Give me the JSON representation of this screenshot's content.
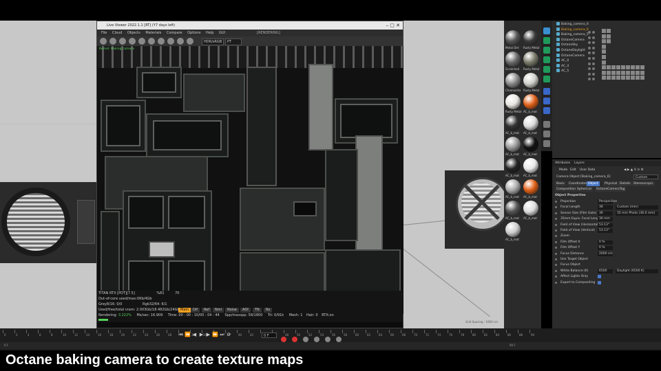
{
  "colors": {
    "accent_orange": "#f0a020",
    "selection_blue": "#4a79c8",
    "stat_green": "#58d15a",
    "viewport_grey": "#c8c8c8"
  },
  "caption": "Octane baking camera to create texture maps",
  "live_viewer": {
    "title": "Live Viewer 2022.1.1 [RT] (Y7 days left)",
    "menu": [
      "File",
      "Cloud",
      "Objects",
      "Materials",
      "Compare",
      "Options",
      "Help",
      "GUI"
    ],
    "status": "[RENDERING]",
    "toolbar": {
      "kernel_select": "HDR/sRGB",
      "mode_select": "PT"
    },
    "overlay_label": "Kernel: Baking camera",
    "stats": {
      "gpu": "TITAN RTX [PDT][7.5]",
      "gpu_pct": "%81",
      "gpu_temp": "70",
      "ooc": "Out-of-core used/max:0Kb/4Gb",
      "grey": "Grey8/16: 0/0",
      "rgb": "Rgb32/64: 6/1",
      "vram": "Used/free/total vram: 2.003Gb/18.482Gb/24Gb",
      "buttons": [
        "Main",
        "Dif",
        "Ref",
        "Nml",
        "Noise",
        "AOI",
        "TN",
        "Ro"
      ],
      "rendering_label": "Rendering:",
      "rendering_pct": "3.222%",
      "ms_sec": "Ms/sec: 16.909",
      "time": "Time: 00 : 00 : 10/00 : 04 : 44",
      "spp": "Spp/maxspp: 58/1800",
      "tri": "Tri: 0/91k",
      "mesh": "Mesh: 1",
      "hair": "Hair: 0",
      "rtx": "RTX:on"
    }
  },
  "materials": [
    {
      "label": "Metal Dirt",
      "color": "#555"
    },
    {
      "label": "Rusty Metal",
      "color": "#3a3a3a"
    },
    {
      "label": "Scratched",
      "color": "#6a6a6a"
    },
    {
      "label": "Rusty Metal",
      "color": "#7a7a6a"
    },
    {
      "label": "Chamoisite",
      "color": "#8a8a8a"
    },
    {
      "label": "Rusty Metal",
      "color": "#d0d0cc"
    },
    {
      "label": "Rusty Metal",
      "color": "#e8e6e0"
    },
    {
      "label": "AC_b_mat",
      "color": "#e06018"
    },
    {
      "label": "AC_b_mat",
      "color": "#333"
    },
    {
      "label": "AC_b_mat",
      "color": "#ddd"
    },
    {
      "label": "AC_b_mat",
      "color": "#999"
    },
    {
      "label": "AC_b_mat",
      "color": "#111"
    },
    {
      "label": "AC_b_mat",
      "color": "#222"
    },
    {
      "label": "AC_b_mat",
      "color": "#e8e8e8"
    },
    {
      "label": "AC_b_mat",
      "color": "#aaa"
    },
    {
      "label": "AC_b_mat",
      "color": "#e06018"
    },
    {
      "label": "AC_b_mat",
      "color": "#555"
    },
    {
      "label": "AC_b_mat",
      "color": "#ddd"
    },
    {
      "label": "AC_b_mat",
      "color": "#ccc"
    }
  ],
  "objects": [
    {
      "name": "Baking_camera_0",
      "orange": false
    },
    {
      "name": "Baking_camera_6",
      "orange": true
    },
    {
      "name": "Baking_camera_5",
      "orange": false
    },
    {
      "name": "OctaneCamera",
      "orange": false
    },
    {
      "name": "OctaneSky",
      "orange": false
    },
    {
      "name": "OctaneDaylight",
      "orange": false
    },
    {
      "name": "OctaneCamera",
      "orange": false
    },
    {
      "name": "AC_0",
      "orange": false
    },
    {
      "name": "AC_4",
      "orange": false
    },
    {
      "name": "AC_5",
      "orange": false
    }
  ],
  "attributes": {
    "tabs": [
      "Attributes",
      "Layers"
    ],
    "menus": [
      "Mode",
      "Edit",
      "User Data"
    ],
    "header": "Camera Object [Baking_camera_6]",
    "mode": "Custom",
    "page_tabs": [
      "Basic",
      "Coordinates",
      "Object",
      "Physical",
      "Details",
      "Stereoscopic",
      "Composition",
      "Spherical",
      "OctaneCameraTag"
    ],
    "section": "Object Properties",
    "rows": [
      {
        "label": "Projection",
        "value": "Perspective",
        "value2": ""
      },
      {
        "label": "Focal Length",
        "value": "36",
        "value2": "Custom (mm)"
      },
      {
        "label": "Sensor Size (Film Gate)",
        "value": "36",
        "value2": "35 mm Photo (36.0 mm)"
      },
      {
        "label": "35mm Equiv. Focal Length:",
        "value": "36 mm",
        "value2": ""
      },
      {
        "label": "Field of View (Horizontal)",
        "value": "53.13°",
        "value2": ""
      },
      {
        "label": "Field of View (Vertical)",
        "value": "53.13°",
        "value2": ""
      },
      {
        "label": "Zoom",
        "value": "",
        "value2": ""
      },
      {
        "label": "Film Offset X",
        "value": "0 %",
        "value2": ""
      },
      {
        "label": "Film Offset Y",
        "value": "0 %",
        "value2": ""
      },
      {
        "label": "Focus Distance",
        "value": "2000 cm",
        "value2": ""
      },
      {
        "label": "Use Target Object",
        "value": "",
        "value2": ""
      },
      {
        "label": "Focus Object",
        "value": "",
        "value2": ""
      },
      {
        "label": "White Balance (K)",
        "value": "6500",
        "value2": "Daylight (6500 K)"
      },
      {
        "label": "Affect Lights Only",
        "value": "",
        "value2": ""
      },
      {
        "label": "Export to Compositing",
        "value": "",
        "value2": ""
      }
    ]
  },
  "timeline": {
    "ticks": [
      "0",
      "2",
      "4",
      "6",
      "8",
      "10",
      "12",
      "14",
      "16",
      "18",
      "20",
      "22",
      "24",
      "26",
      "28",
      "30",
      "32",
      "34",
      "36",
      "38",
      "40",
      "42",
      "44",
      "46",
      "48",
      "50",
      "52",
      "54",
      "56",
      "58",
      "60",
      "62",
      "64",
      "66",
      "68",
      "70",
      "72",
      "74",
      "76",
      "78",
      "80",
      "82",
      "84",
      "86",
      "88",
      "90"
    ],
    "current_frame": "0 F",
    "start": "0 F",
    "end": "90 F"
  },
  "viewport_info": "Grid Spacing : 1000 cm"
}
